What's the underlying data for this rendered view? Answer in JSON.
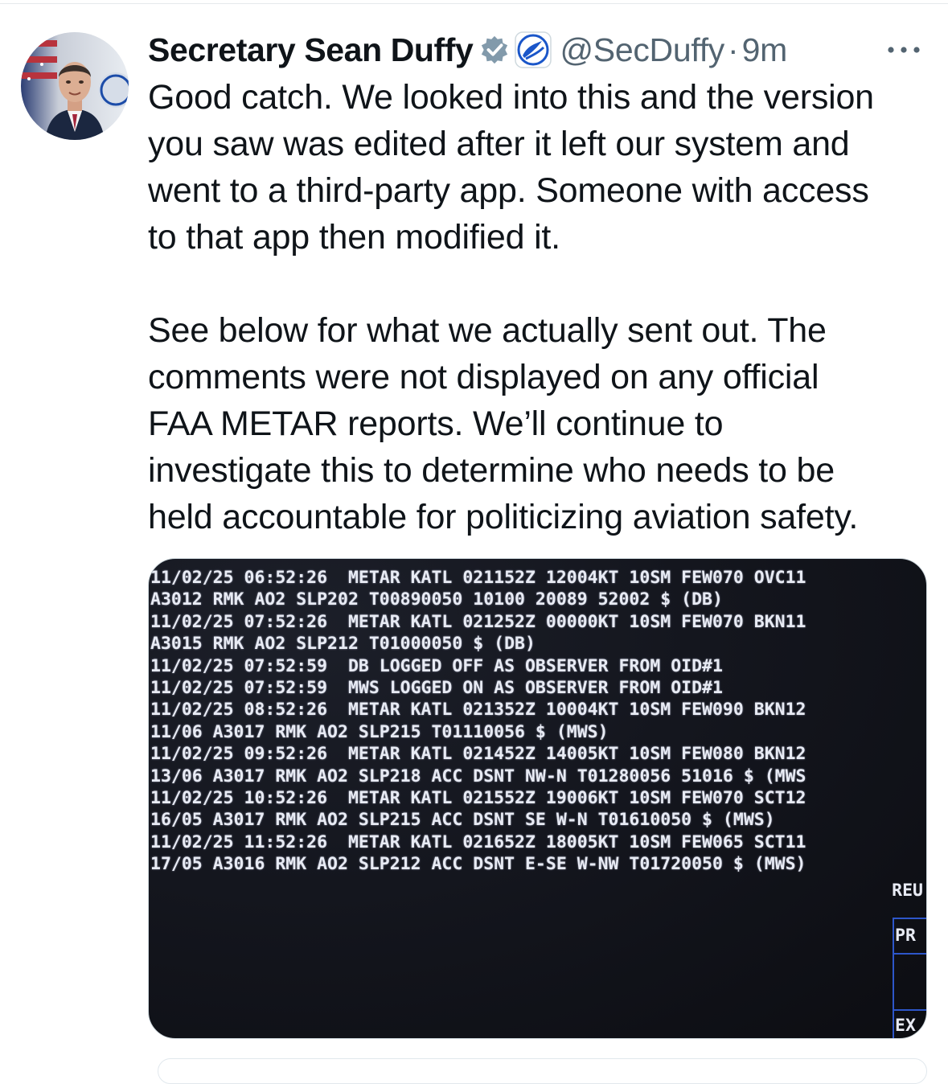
{
  "tweet": {
    "author": {
      "display_name": "Secretary Sean Duffy",
      "handle": "@SecDuffy",
      "verified_badge": "gray-check",
      "affiliate_badge": "dot-logo"
    },
    "separator": "·",
    "time": "9m",
    "more_icon": "more-horizontal-icon",
    "paragraph_1": "Good catch. We looked into this and the version\nyou saw was edited after it left our system and\nwent to a third-party app. Someone with access\nto that app then modified it.",
    "paragraph_2": "See below for what we actually sent out. The\ncomments were not displayed on any official\nFAA METAR reports. We’ll continue to\ninvestigate this to determine who needs to be\nheld accountable for politicizing aviation safety."
  },
  "media": {
    "terminal_lines": [
      "11/02/25 06:52:26  METAR KATL 021152Z 12004KT 10SM FEW070 OVC11",
      "A3012 RMK AO2 SLP202 T00890050 10100 20089 52002 $ (DB)",
      "11/02/25 07:52:26  METAR KATL 021252Z 00000KT 10SM FEW070 BKN11",
      "A3015 RMK AO2 SLP212 T01000050 $ (DB)",
      "11/02/25 07:52:59  DB LOGGED OFF AS OBSERVER FROM OID#1",
      "11/02/25 07:52:59  MWS LOGGED ON AS OBSERVER FROM OID#1",
      "11/02/25 08:52:26  METAR KATL 021352Z 10004KT 10SM FEW090 BKN12",
      "11/06 A3017 RMK AO2 SLP215 T01110056 $ (MWS)",
      "11/02/25 09:52:26  METAR KATL 021452Z 14005KT 10SM FEW080 BKN12",
      "13/06 A3017 RMK AO2 SLP218 ACC DSNT NW-N T01280056 51016 $ (MWS",
      "11/02/25 10:52:26  METAR KATL 021552Z 19006KT 10SM FEW070 SCT12",
      "16/05 A3017 RMK AO2 SLP215 ACC DSNT SE W-N T01610050 $ (MWS)",
      "11/02/25 11:52:26  METAR KATL 021652Z 18005KT 10SM FEW065 SCT11",
      "17/05 A3016 RMK AO2 SLP212 ACC DSNT E-SE W-NW T01720050 $ (MWS)"
    ],
    "rev_label": "REU",
    "pr_label": "PR",
    "ex_label": "EX"
  },
  "colors": {
    "text_primary": "#0f1419",
    "text_secondary": "#536471",
    "verified_gray": "#829aab",
    "affiliate_blue": "#1a56c9",
    "terminal_bg": "#14161e",
    "terminal_text": "#e8ebf4"
  }
}
